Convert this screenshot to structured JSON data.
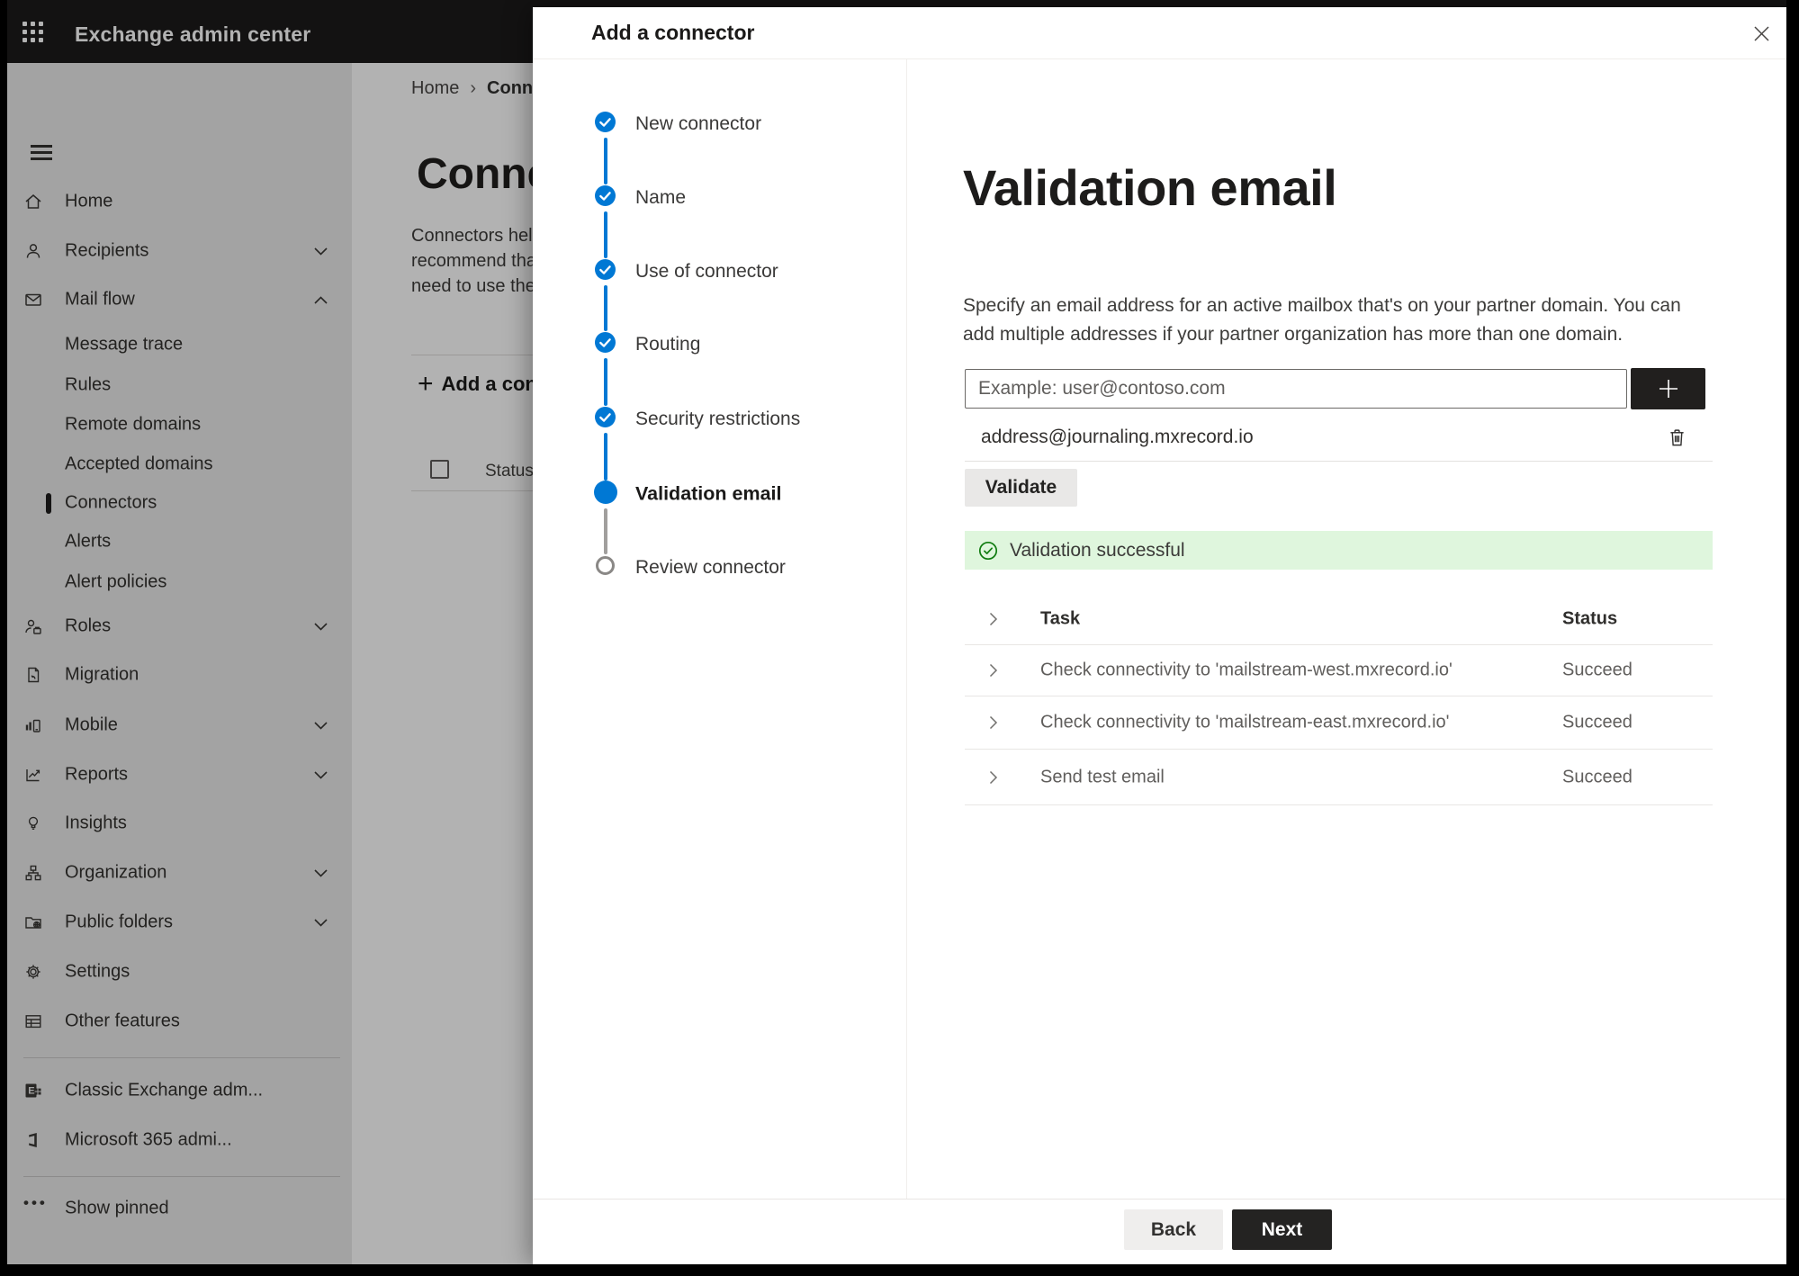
{
  "topbar": {
    "app_title": "Exchange admin center"
  },
  "sidebar": {
    "items": [
      {
        "label": "Home"
      },
      {
        "label": "Recipients"
      },
      {
        "label": "Mail flow"
      },
      {
        "label": "Message trace"
      },
      {
        "label": "Rules"
      },
      {
        "label": "Remote domains"
      },
      {
        "label": "Accepted domains"
      },
      {
        "label": "Connectors"
      },
      {
        "label": "Alerts"
      },
      {
        "label": "Alert policies"
      },
      {
        "label": "Roles"
      },
      {
        "label": "Migration"
      },
      {
        "label": "Mobile"
      },
      {
        "label": "Reports"
      },
      {
        "label": "Insights"
      },
      {
        "label": "Organization"
      },
      {
        "label": "Public folders"
      },
      {
        "label": "Settings"
      },
      {
        "label": "Other features"
      },
      {
        "label": "Classic Exchange adm..."
      },
      {
        "label": "Microsoft 365 admi..."
      },
      {
        "label": "Show pinned"
      }
    ]
  },
  "background_page": {
    "breadcrumb": {
      "home": "Home",
      "separator": "›",
      "current": "Conne"
    },
    "page_title": "Connec",
    "description_lines": [
      "Connectors help",
      "recommend that",
      "need to use ther"
    ],
    "add_button_label": "Add a conn",
    "add_button_plus": "+",
    "status_column_label": "Status"
  },
  "modal": {
    "title": "Add a connector",
    "steps": [
      {
        "label": "New connector",
        "state": "completed"
      },
      {
        "label": "Name",
        "state": "completed"
      },
      {
        "label": "Use of connector",
        "state": "completed"
      },
      {
        "label": "Routing",
        "state": "completed"
      },
      {
        "label": "Security restrictions",
        "state": "completed"
      },
      {
        "label": "Validation email",
        "state": "current"
      },
      {
        "label": "Review connector",
        "state": "upcoming"
      }
    ],
    "content": {
      "heading": "Validation email",
      "description": "Specify an email address for an active mailbox that's on your partner domain. You can add multiple addresses if your partner organization has more than one domain.",
      "email_input_placeholder": "Example: user@contoso.com",
      "email_input_value": "",
      "added_address": "address@journaling.mxrecord.io",
      "validate_button_label": "Validate",
      "success_banner_text": "Validation successful",
      "results_table": {
        "task_header": "Task",
        "status_header": "Status",
        "rows": [
          {
            "task": "Check connectivity to 'mailstream-west.mxrecord.io'",
            "status": "Succeed"
          },
          {
            "task": "Check connectivity to 'mailstream-east.mxrecord.io'",
            "status": "Succeed"
          },
          {
            "task": "Send test email",
            "status": "Succeed"
          }
        ]
      }
    },
    "footer": {
      "back_label": "Back",
      "next_label": "Next"
    }
  },
  "colors": {
    "accent": "#0078d4",
    "success_background": "#dff6dd",
    "success_green": "#107c10",
    "dark_button": "#252423",
    "topbar": "#1c1b1a"
  }
}
